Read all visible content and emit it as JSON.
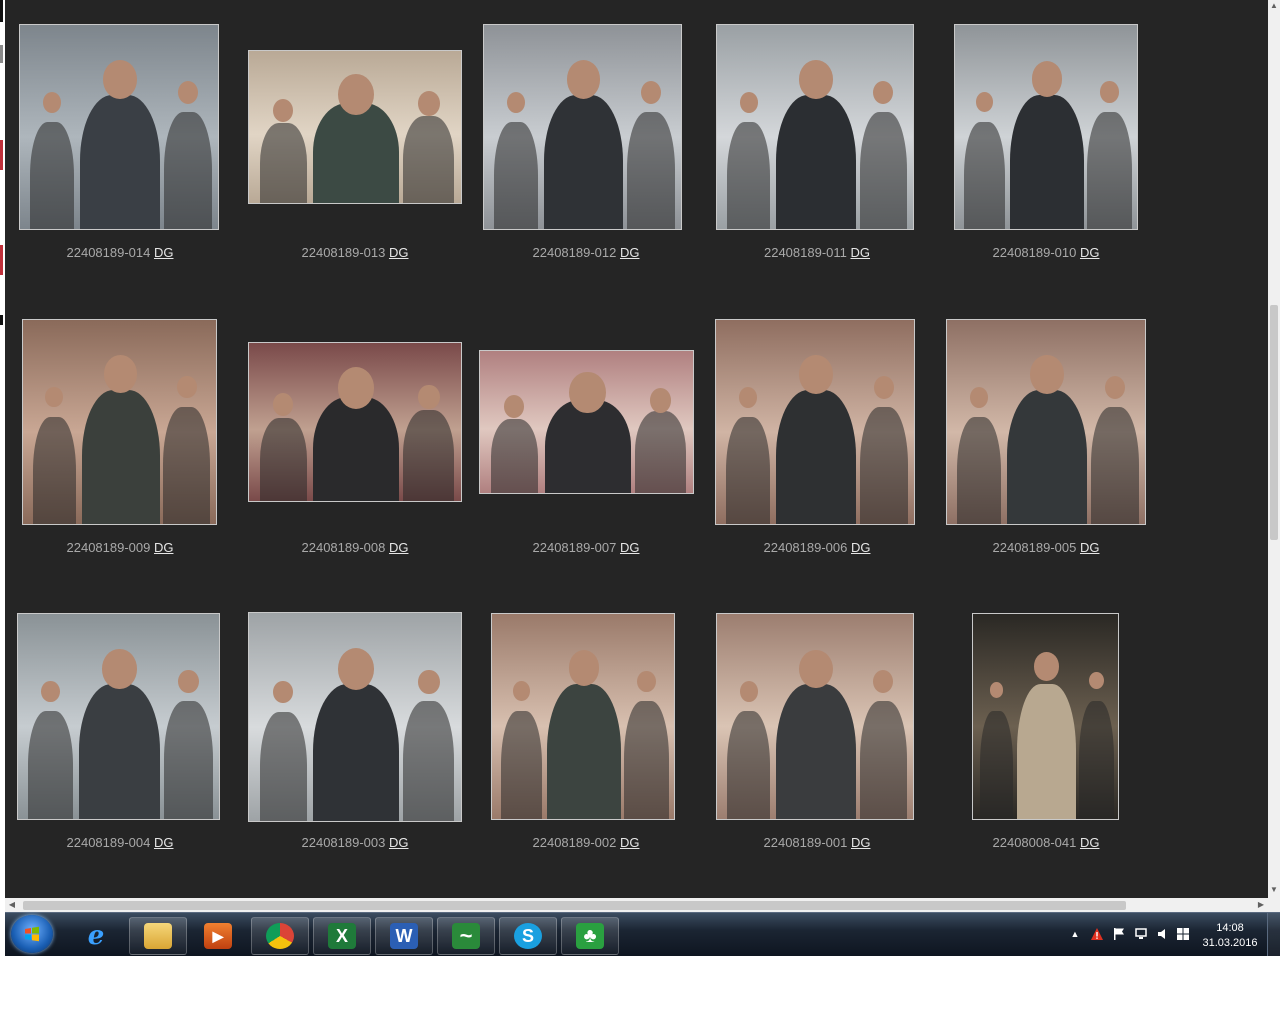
{
  "gallery": {
    "link_label": "DG",
    "items": [
      {
        "id": "22408189-014"
      },
      {
        "id": "22408189-013"
      },
      {
        "id": "22408189-012"
      },
      {
        "id": "22408189-011"
      },
      {
        "id": "22408189-010"
      },
      {
        "id": "22408189-009"
      },
      {
        "id": "22408189-008"
      },
      {
        "id": "22408189-007"
      },
      {
        "id": "22408189-006"
      },
      {
        "id": "22408189-005"
      },
      {
        "id": "22408189-004"
      },
      {
        "id": "22408189-003"
      },
      {
        "id": "22408189-002"
      },
      {
        "id": "22408189-001"
      },
      {
        "id": "22408008-041"
      }
    ]
  },
  "taskbar": {
    "apps": [
      {
        "name": "internet-explorer",
        "icon": "e"
      },
      {
        "name": "file-explorer",
        "icon": ""
      },
      {
        "name": "media-player",
        "icon": "▶"
      },
      {
        "name": "chrome",
        "icon": ""
      },
      {
        "name": "excel",
        "icon": "X"
      },
      {
        "name": "word",
        "icon": "W"
      },
      {
        "name": "app-tilde",
        "icon": "~"
      },
      {
        "name": "skype",
        "icon": "S"
      },
      {
        "name": "app-clover",
        "icon": "♣"
      }
    ],
    "clock": {
      "time": "14:08",
      "date": "31.03.2016"
    }
  },
  "colors": {
    "gallery_bg": "#252525",
    "caption_text": "#a9a9a9",
    "link_text": "#e6e6e6"
  }
}
